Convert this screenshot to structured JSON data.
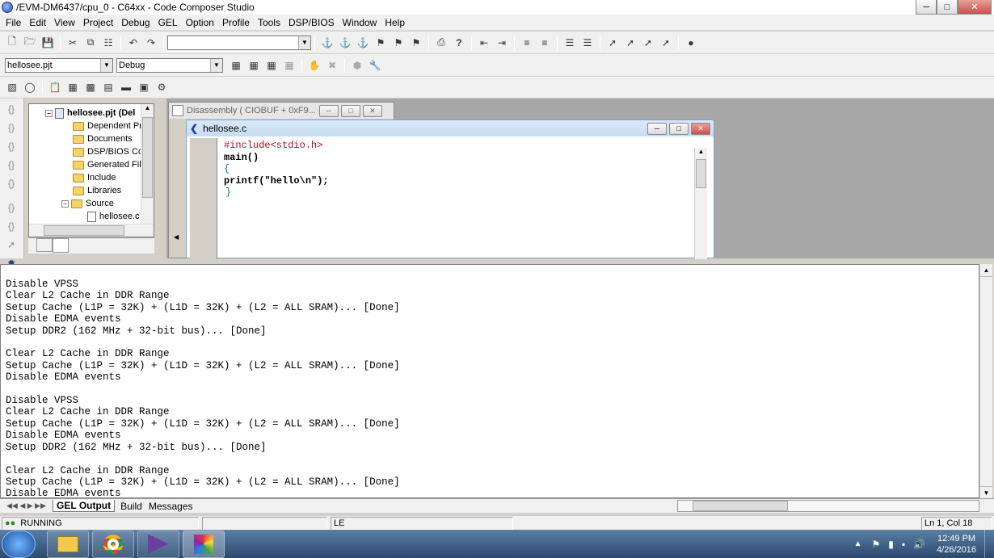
{
  "window": {
    "title": "/EVM-DM6437/cpu_0 - C64xx - Code Composer Studio"
  },
  "menu": [
    "File",
    "Edit",
    "View",
    "Project",
    "Debug",
    "GEL",
    "Option",
    "Profile",
    "Tools",
    "DSP/BIOS",
    "Window",
    "Help"
  ],
  "toolbar": {
    "search_value": "",
    "project_combo": "hellosee.pjt",
    "config_combo": "Debug"
  },
  "project_tree": {
    "root": "hellosee.pjt (Del",
    "items": [
      "Dependent Pr",
      "Documents",
      "DSP/BIOS Cor",
      "Generated File",
      "Include",
      "Libraries",
      "Source"
    ],
    "file": "hellosee.c"
  },
  "disassembly": {
    "title": "Disassembly ( CIOBUF  + 0xF9..."
  },
  "editor": {
    "title": "hellosee.c",
    "lines": [
      "#include<stdio.h>",
      "main()",
      "{",
      "printf(\"hello\\n\");",
      "}"
    ]
  },
  "output": {
    "lines": [
      "Disable VPSS",
      "Clear L2 Cache in DDR Range",
      "Setup Cache (L1P = 32K) + (L1D = 32K) + (L2 = ALL SRAM)... [Done]",
      "Disable EDMA events",
      "Setup DDR2 (162 MHz + 32-bit bus)... [Done]",
      "",
      "Clear L2 Cache in DDR Range",
      "Setup Cache (L1P = 32K) + (L1D = 32K) + (L2 = ALL SRAM)... [Done]",
      "Disable EDMA events",
      "",
      "Disable VPSS",
      "Clear L2 Cache in DDR Range",
      "Setup Cache (L1P = 32K) + (L1D = 32K) + (L2 = ALL SRAM)... [Done]",
      "Disable EDMA events",
      "Setup DDR2 (162 MHz + 32-bit bus)... [Done]",
      "",
      "Clear L2 Cache in DDR Range",
      "Setup Cache (L1P = 32K) + (L1D = 32K) + (L2 = ALL SRAM)... [Done]",
      "Disable EDMA events"
    ]
  },
  "bottom_tabs": [
    "GEL Output",
    "Build",
    "Messages"
  ],
  "status": {
    "run_state": "RUNNING",
    "endian": "LE",
    "position": "Ln 1, Col 18"
  },
  "taskbar": {
    "time": "12:49 PM",
    "date": "4/26/2016"
  },
  "colors": {
    "keyword": "#c8001e",
    "bracket": "#008080",
    "title_active": "#c9e0f7"
  }
}
